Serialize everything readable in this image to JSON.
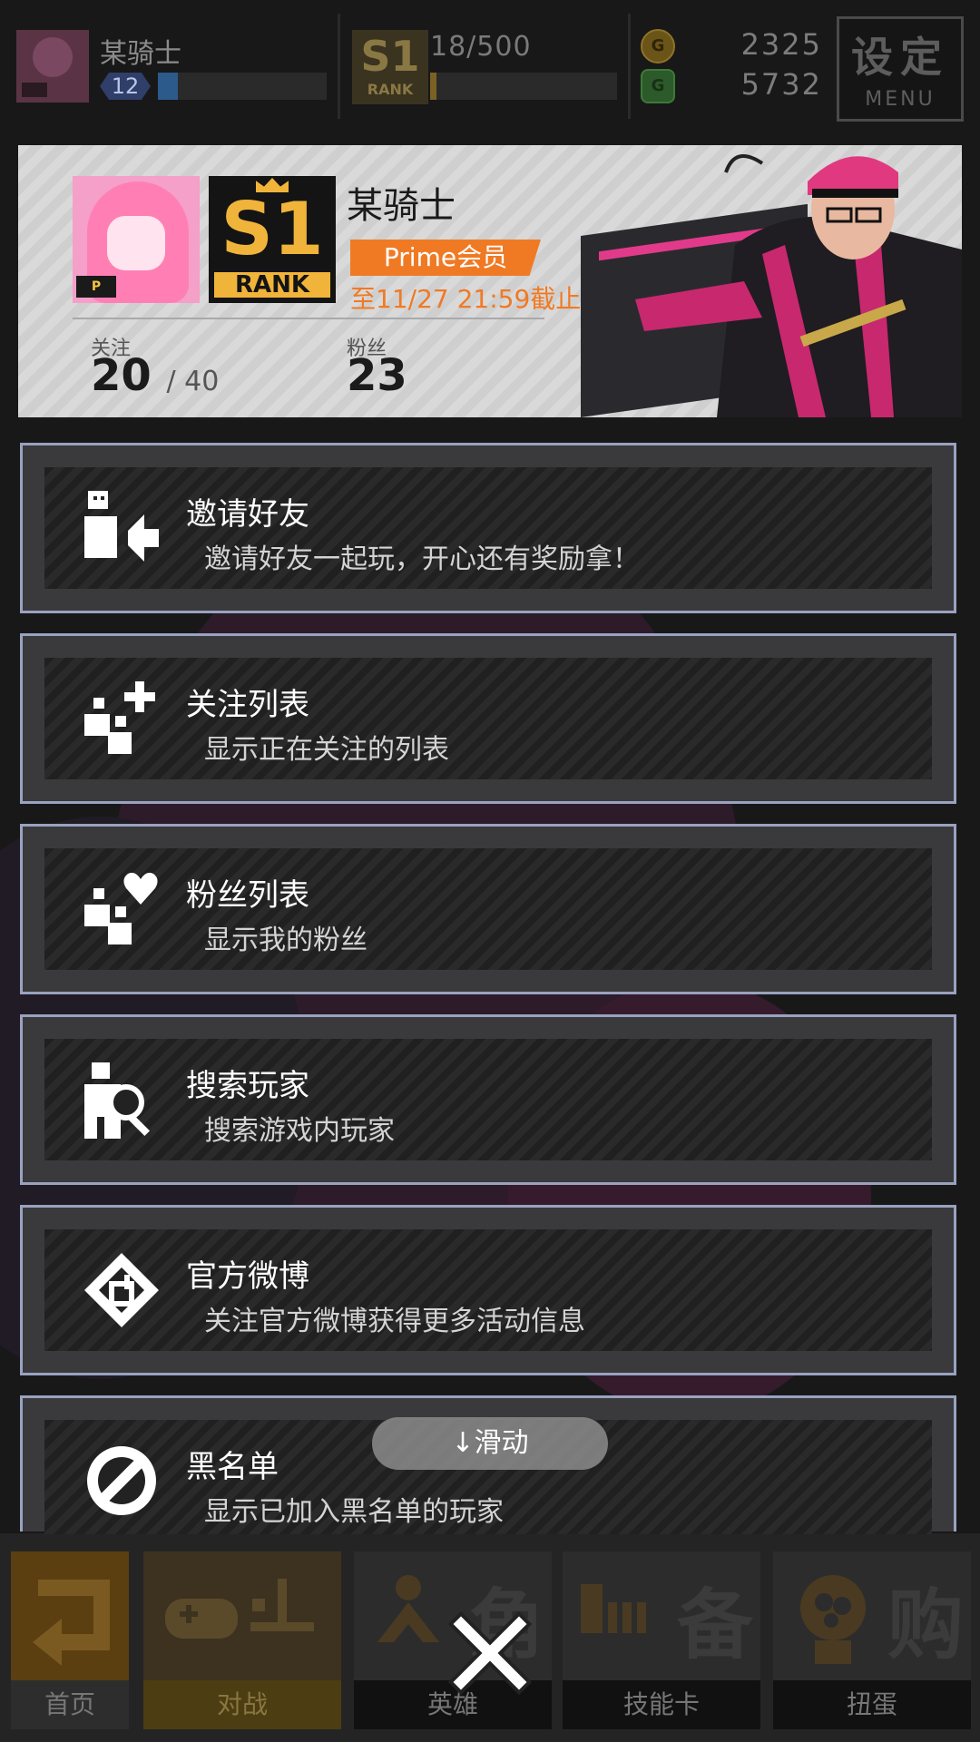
{
  "topbar": {
    "player_name": "某骑士",
    "level": "12",
    "exp_fraction": 0.12,
    "rank_badge": "S1",
    "rank_badge_sub": "RANK",
    "rank_progress": "18/500",
    "rank_fraction": 0.036,
    "gold": "2325",
    "gems": "5732",
    "menu_title": "设定",
    "menu_sub": "MENU"
  },
  "profile": {
    "avatar_tag": "P",
    "rank_number": "S1",
    "rank_label": "RANK",
    "name": "某骑士",
    "membership": "Prime会员",
    "expiry": "至11/27 21:59截止",
    "following_label": "关注",
    "following_value": "20",
    "following_max": "/ 40",
    "fans_label": "粉丝",
    "fans_value": "23"
  },
  "menu": [
    {
      "title": "邀请好友",
      "desc": "邀请好友一起玩，开心还有奖励拿！"
    },
    {
      "title": "关注列表",
      "desc": "显示正在关注的列表"
    },
    {
      "title": "粉丝列表",
      "desc": "显示我的粉丝"
    },
    {
      "title": "搜索玩家",
      "desc": "搜索游戏内玩家"
    },
    {
      "title": "官方微博",
      "desc": "关注官方微博获得更多活动信息"
    },
    {
      "title": "黑名单",
      "desc": "显示已加入黑名单的玩家"
    }
  ],
  "scroll_hint": "↓滑动",
  "nav": {
    "home": "首页",
    "battle": "对战",
    "hero": "英雄",
    "hero_big": "角",
    "skillcard": "技能卡",
    "skillcard_big": "备",
    "gacha": "扭蛋",
    "gacha_big": "购"
  },
  "colors": {
    "accent_orange": "#f07a24",
    "rank_gold": "#f0b43a",
    "item_border": "#9aa2c0"
  }
}
